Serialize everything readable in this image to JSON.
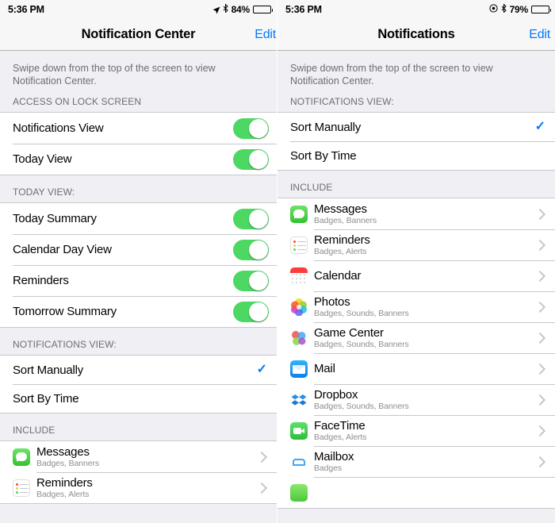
{
  "left": {
    "status": {
      "time": "5:36 PM",
      "battery_pct": "84%",
      "icons": [
        "location-arrow-icon",
        "bluetooth-icon",
        "battery-icon"
      ]
    },
    "nav": {
      "title": "Notification Center",
      "action": "Edit"
    },
    "blurb": "Swipe down from the top of the screen to view Notification Center.",
    "sections": [
      {
        "header": "ACCESS ON LOCK SCREEN",
        "rows": [
          {
            "label": "Notifications View",
            "control": "switch",
            "on": true
          },
          {
            "label": "Today View",
            "control": "switch",
            "on": true
          }
        ]
      },
      {
        "header": "TODAY VIEW:",
        "rows": [
          {
            "label": "Today Summary",
            "control": "switch",
            "on": true
          },
          {
            "label": "Calendar Day View",
            "control": "switch",
            "on": true
          },
          {
            "label": "Reminders",
            "control": "switch",
            "on": true
          },
          {
            "label": "Tomorrow Summary",
            "control": "switch",
            "on": true
          }
        ]
      },
      {
        "header": "NOTIFICATIONS VIEW:",
        "rows": [
          {
            "label": "Sort Manually",
            "control": "check",
            "selected": true
          },
          {
            "label": "Sort By Time",
            "control": "none",
            "selected": false
          }
        ]
      },
      {
        "header": "INCLUDE",
        "apps": [
          {
            "name": "Messages",
            "sub": "Badges, Banners",
            "icon": "messages-icon"
          },
          {
            "name": "Reminders",
            "sub": "Badges, Alerts",
            "icon": "reminders-icon"
          }
        ]
      }
    ]
  },
  "right": {
    "status": {
      "time": "5:36 PM",
      "battery_pct": "79%",
      "icons": [
        "do-not-disturb-icon",
        "bluetooth-icon",
        "battery-icon"
      ]
    },
    "nav": {
      "title": "Notifications",
      "action": "Edit"
    },
    "blurb": "Swipe down from the top of the screen to view Notification Center.",
    "sections": [
      {
        "header": "NOTIFICATIONS VIEW:",
        "rows": [
          {
            "label": "Sort Manually",
            "control": "check",
            "selected": true
          },
          {
            "label": "Sort By Time",
            "control": "none",
            "selected": false
          }
        ]
      },
      {
        "header": "INCLUDE",
        "apps": [
          {
            "name": "Messages",
            "sub": "Badges, Banners",
            "icon": "messages-icon"
          },
          {
            "name": "Reminders",
            "sub": "Badges, Alerts",
            "icon": "reminders-icon"
          },
          {
            "name": "Calendar",
            "sub": "",
            "icon": "calendar-icon"
          },
          {
            "name": "Photos",
            "sub": "Badges, Sounds, Banners",
            "icon": "photos-icon"
          },
          {
            "name": "Game Center",
            "sub": "Badges, Sounds, Banners",
            "icon": "game-center-icon"
          },
          {
            "name": "Mail",
            "sub": "",
            "icon": "mail-icon"
          },
          {
            "name": "Dropbox",
            "sub": "Badges, Sounds, Banners",
            "icon": "dropbox-icon"
          },
          {
            "name": "FaceTime",
            "sub": "Badges, Alerts",
            "icon": "facetime-icon"
          },
          {
            "name": "Mailbox",
            "sub": "Badges",
            "icon": "mailbox-icon"
          }
        ]
      }
    ]
  },
  "colors": {
    "switch_on": "#4cd863",
    "tint": "#027aff",
    "group_bg": "#efeff4",
    "separator": "#c8c7cc",
    "secondary_text": "#6d6d72"
  }
}
